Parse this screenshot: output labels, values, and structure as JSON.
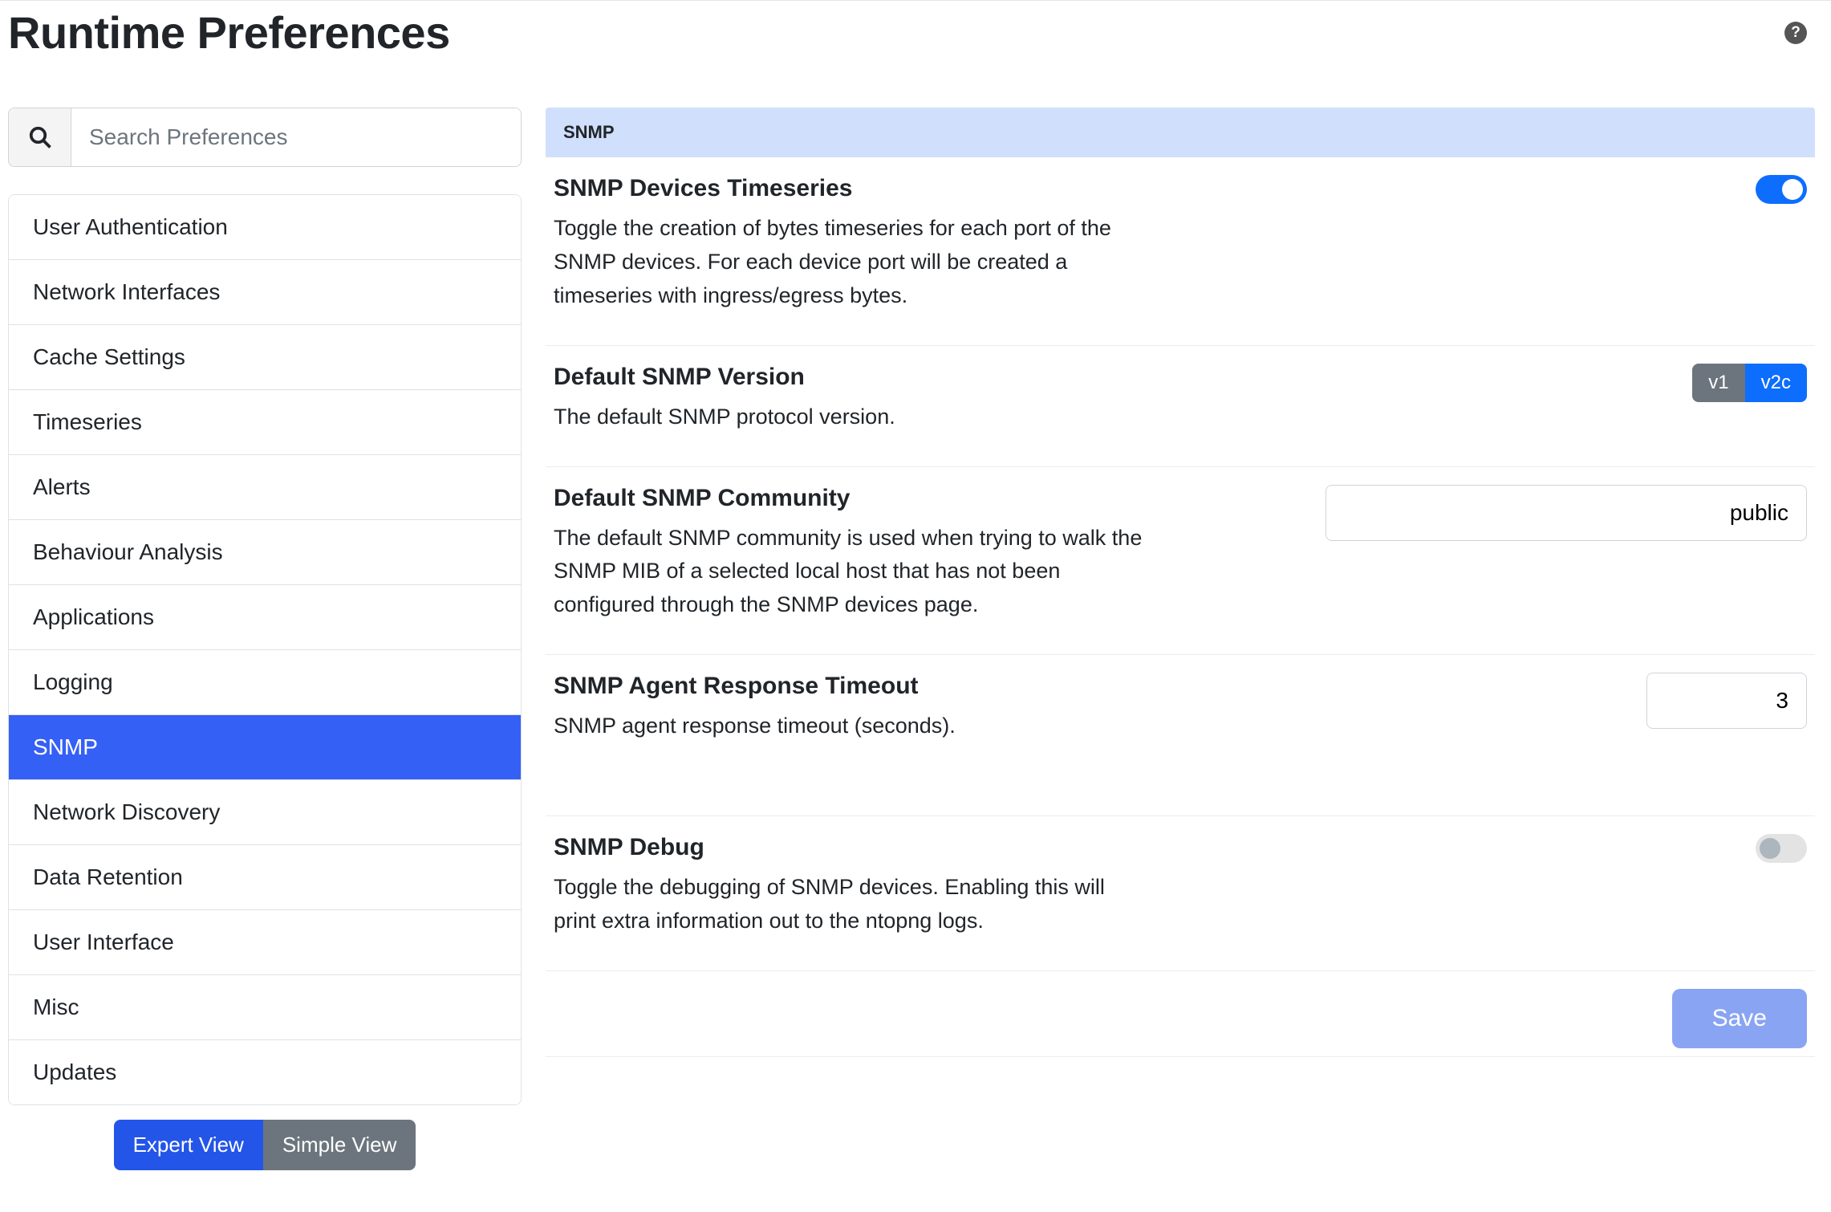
{
  "header": {
    "title": "Runtime Preferences",
    "help_glyph": "?"
  },
  "sidebar": {
    "search_placeholder": "Search Preferences",
    "items": [
      {
        "label": "User Authentication",
        "active": false
      },
      {
        "label": "Network Interfaces",
        "active": false
      },
      {
        "label": "Cache Settings",
        "active": false
      },
      {
        "label": "Timeseries",
        "active": false
      },
      {
        "label": "Alerts",
        "active": false
      },
      {
        "label": "Behaviour Analysis",
        "active": false
      },
      {
        "label": "Applications",
        "active": false
      },
      {
        "label": "Logging",
        "active": false
      },
      {
        "label": "SNMP",
        "active": true
      },
      {
        "label": "Network Discovery",
        "active": false
      },
      {
        "label": "Data Retention",
        "active": false
      },
      {
        "label": "User Interface",
        "active": false
      },
      {
        "label": "Misc",
        "active": false
      },
      {
        "label": "Updates",
        "active": false
      }
    ],
    "view_toggle": {
      "expert": "Expert View",
      "simple": "Simple View",
      "selected": "expert"
    }
  },
  "main": {
    "section_title": "SNMP",
    "save_label": "Save",
    "settings": {
      "timeseries": {
        "title": "SNMP Devices Timeseries",
        "desc": "Toggle the creation of bytes timeseries for each port of the SNMP devices. For each device port will be created a timeseries with ingress/egress bytes.",
        "enabled": true
      },
      "version": {
        "title": "Default SNMP Version",
        "desc": "The default SNMP protocol version.",
        "options": {
          "v1": "v1",
          "v2c": "v2c"
        },
        "selected": "v2c"
      },
      "community": {
        "title": "Default SNMP Community",
        "desc": "The default SNMP community is used when trying to walk the SNMP MIB of a selected local host that has not been configured through the SNMP devices page.",
        "value": "public"
      },
      "timeout": {
        "title": "SNMP Agent Response Timeout",
        "desc": "SNMP agent response timeout (seconds).",
        "value": "3"
      },
      "debug": {
        "title": "SNMP Debug",
        "desc": "Toggle the debugging of SNMP devices. Enabling this will print extra information out to the ntopng logs.",
        "enabled": false
      }
    }
  }
}
